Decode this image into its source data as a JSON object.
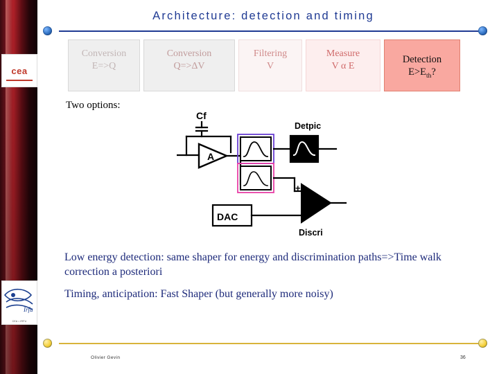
{
  "slide": {
    "title": "Architecture: detection and timing",
    "two_options_label": "Two options:",
    "paragraph1": "Low energy detection: same shaper for energy and discrimination paths=>Time walk correction a posteriori",
    "paragraph2": "Timing, anticipation: Fast Shaper (but generally more noisy)"
  },
  "chain": {
    "boxes": [
      {
        "line1": "Conversion",
        "line2": "E=>Q",
        "state": "inactive"
      },
      {
        "line1": "Conversion",
        "line2": "Q=>ΔV",
        "state": "inactive"
      },
      {
        "line1": "Filtering",
        "line2": "V",
        "state": "inactive"
      },
      {
        "line1": "Measure",
        "line2": "V α E",
        "state": "inactive"
      },
      {
        "line1": "Detection",
        "line2": "E>Eth?",
        "state": "active"
      }
    ]
  },
  "schematic": {
    "labels": {
      "cf": "Cf",
      "amp": "A",
      "detpic": "Detpic",
      "dac": "DAC",
      "discri": "Discri",
      "plus": "+"
    }
  },
  "footer": {
    "author": "Olivier Gevin",
    "page": "36"
  },
  "logos": {
    "cea": "cea",
    "irfu_caption": "CEA    •    IRFU"
  },
  "colors": {
    "title": "#1f3a93",
    "body_text": "#1d2a7a",
    "active_box": "#f9a8a0",
    "rule_top": "#1f3a93",
    "rule_bottom": "#d8b43a"
  }
}
